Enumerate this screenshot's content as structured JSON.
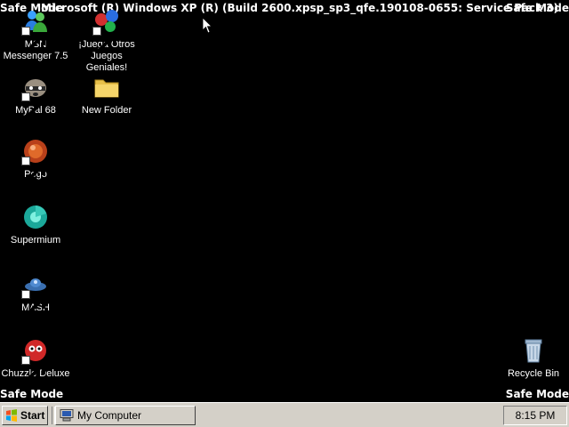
{
  "watermark": {
    "top_left": "Safe Mode",
    "top_center": "Microsoft (R) Windows XP (R) (Build 2600.xpsp_sp3_qfe.190108-0655: Service Pack 3)",
    "top_right": "Safe Mode",
    "bottom_left": "Safe Mode",
    "bottom_right": "Safe Mode"
  },
  "desktop": {
    "icons": [
      {
        "label": "MSN Messenger 7.5",
        "icon": "msn-messenger-icon"
      },
      {
        "label": "¡Juega Otros Juegos Geniales!",
        "icon": "games-icon"
      },
      {
        "label": "MyPal 68",
        "icon": "mypal-raccoon-icon"
      },
      {
        "label": "New Folder",
        "icon": "folder-icon"
      },
      {
        "label": "Pego",
        "icon": "pego-icon"
      },
      {
        "label": "Supermium",
        "icon": "supermium-icon"
      },
      {
        "label": "MASH",
        "icon": "mash-icon"
      },
      {
        "label": "Chuzzle Deluxe",
        "icon": "chuzzle-icon"
      },
      {
        "label": "Recycle Bin",
        "icon": "recycle-bin-icon"
      }
    ]
  },
  "taskbar": {
    "start_label": "Start",
    "tasks": [
      {
        "label": "My Computer",
        "icon": "my-computer-icon"
      }
    ],
    "clock": "8:15 PM"
  },
  "colors": {
    "desktop_bg": "#000000",
    "taskbar_bg": "#d4d0c8",
    "text": "#ffffff"
  }
}
